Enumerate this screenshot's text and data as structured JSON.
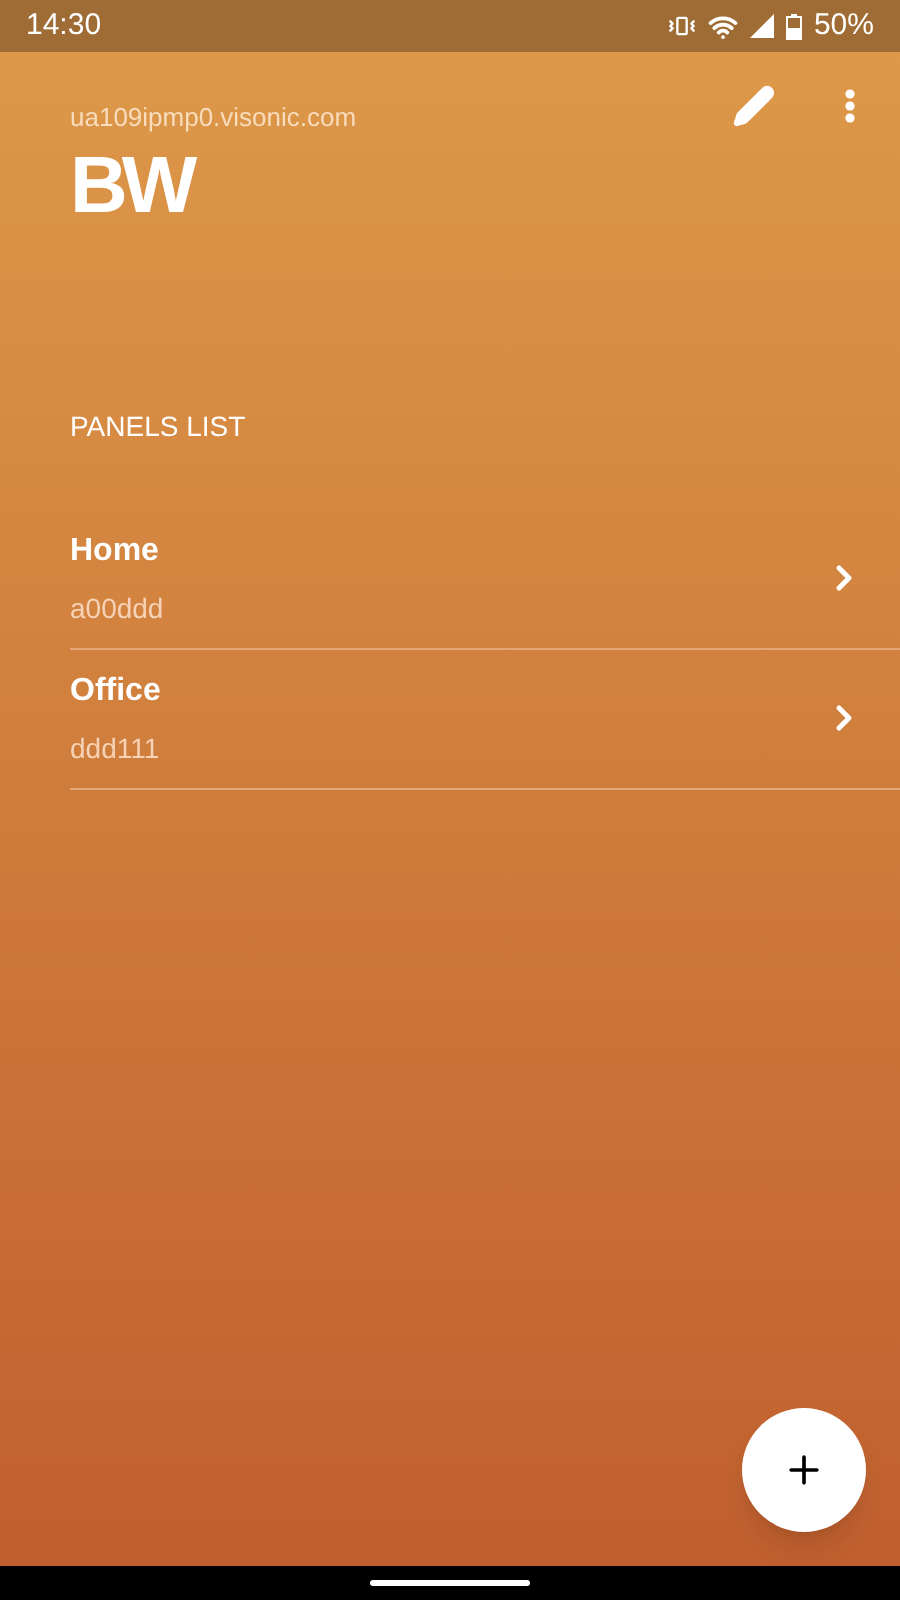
{
  "status_bar": {
    "time": "14:30",
    "battery": "50%"
  },
  "header": {
    "host": "ua109ipmp0.visonic.com",
    "logo": "BW"
  },
  "section_title": "PANELS LIST",
  "panels": [
    {
      "name": "Home",
      "id": "a00ddd"
    },
    {
      "name": "Office",
      "id": "ddd111"
    }
  ]
}
